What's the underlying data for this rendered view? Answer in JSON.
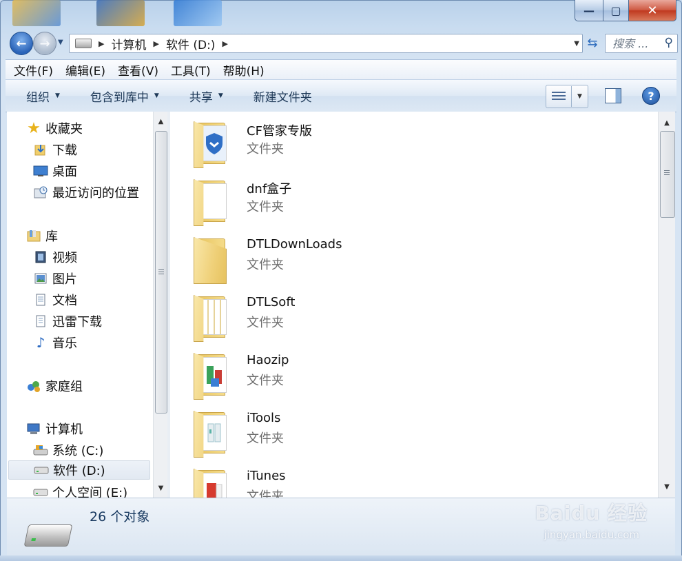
{
  "title_buttons": {
    "minimize": "—",
    "maximize": "▢",
    "close": "✕"
  },
  "address": {
    "crumbs": [
      "计算机",
      "软件 (D:)"
    ],
    "drive_icon": "drive-icon"
  },
  "search": {
    "placeholder": "搜索 ..."
  },
  "menu": [
    "文件(F)",
    "编辑(E)",
    "查看(V)",
    "工具(T)",
    "帮助(H)"
  ],
  "commands": [
    {
      "label": "组织",
      "dropdown": true
    },
    {
      "label": "包含到库中",
      "dropdown": true
    },
    {
      "label": "共享",
      "dropdown": true
    },
    {
      "label": "新建文件夹",
      "dropdown": false
    }
  ],
  "nav_tree": [
    {
      "label": "收藏夹",
      "icon": "star-icon",
      "level": 0
    },
    {
      "label": "下载",
      "icon": "download-folder-icon",
      "level": 1
    },
    {
      "label": "桌面",
      "icon": "desktop-icon",
      "level": 1
    },
    {
      "label": "最近访问的位置",
      "icon": "recent-places-icon",
      "level": 1
    },
    {
      "label": "库",
      "icon": "library-icon",
      "level": 0
    },
    {
      "label": "视频",
      "icon": "video-icon",
      "level": 1
    },
    {
      "label": "图片",
      "icon": "pictures-icon",
      "level": 1
    },
    {
      "label": "文档",
      "icon": "documents-icon",
      "level": 1
    },
    {
      "label": "迅雷下载",
      "icon": "thunder-download-icon",
      "level": 1
    },
    {
      "label": "音乐",
      "icon": "music-icon",
      "level": 1
    },
    {
      "label": "家庭组",
      "icon": "homegroup-icon",
      "level": 0
    },
    {
      "label": "计算机",
      "icon": "computer-icon",
      "level": 0
    },
    {
      "label": "系统 (C:)",
      "icon": "system-drive-icon",
      "level": 1
    },
    {
      "label": "软件 (D:)",
      "icon": "drive-icon",
      "level": 1,
      "selected": true
    },
    {
      "label": "个人空间 (E:)",
      "icon": "drive-icon",
      "level": 1
    }
  ],
  "files": [
    {
      "name": "CF管家专版",
      "type": "文件夹",
      "accent": "#2f6fc6"
    },
    {
      "name": "dnf盒子",
      "type": "文件夹",
      "accent": "#ffffff"
    },
    {
      "name": "DTLDownLoads",
      "type": "文件夹",
      "accent": ""
    },
    {
      "name": "DTLSoft",
      "type": "文件夹",
      "accent": "#e9d28e"
    },
    {
      "name": "Haozip",
      "type": "文件夹",
      "accent": "#3aa25a"
    },
    {
      "name": "iTools",
      "type": "文件夹",
      "accent": "#9fc4ce"
    },
    {
      "name": "iTunes",
      "type": "文件夹",
      "accent": "#d63a2e"
    }
  ],
  "status": {
    "count": "26 个对象"
  },
  "watermark": {
    "main": "Baidu 经验",
    "sub": "jingyan.baidu.com"
  }
}
